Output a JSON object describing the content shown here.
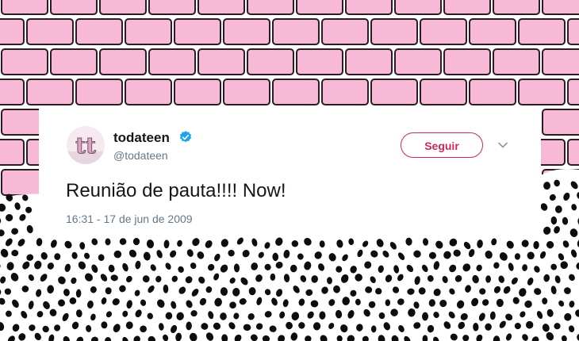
{
  "tweet": {
    "display_name": "todateen",
    "handle": "@todateen",
    "follow_label": "Seguir",
    "text": "Reunião de pauta!!!! Now!",
    "timestamp": "16:31 - 17 de jun de 2009",
    "avatar_glyph": "tt"
  },
  "icons": {
    "verified": "verified-badge-icon",
    "menu": "chevron-down-icon"
  },
  "colors": {
    "brick": "#f7b9d5",
    "accent": "#c92a5a",
    "verified": "#1da1f2"
  }
}
